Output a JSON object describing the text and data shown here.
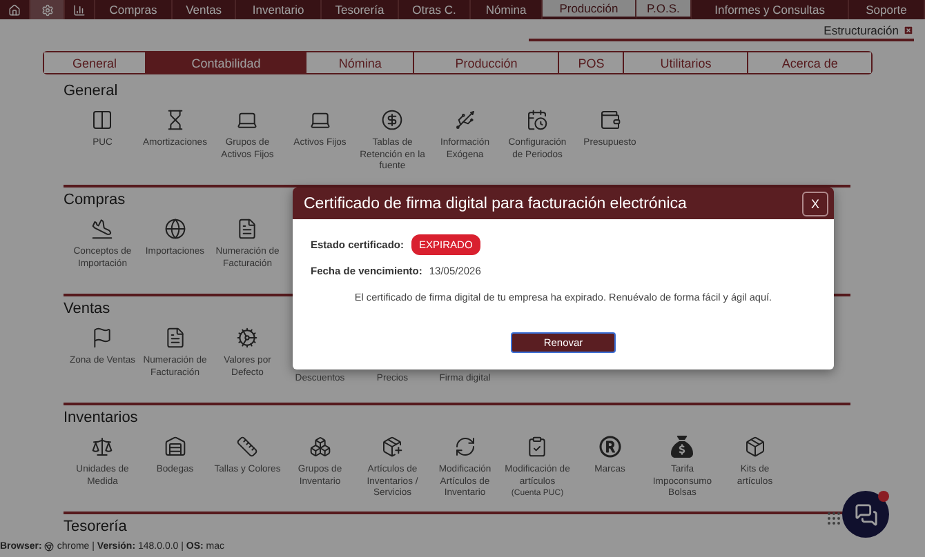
{
  "top_nav": {
    "icon_buttons": [
      {
        "kind": "home",
        "selected": false
      },
      {
        "kind": "settings",
        "selected": true
      },
      {
        "kind": "chart",
        "selected": false
      }
    ],
    "items": [
      {
        "label": "Compras",
        "selected": false
      },
      {
        "label": "Ventas",
        "selected": false
      },
      {
        "label": "Inventario",
        "selected": false
      },
      {
        "label": "Tesorería",
        "selected": false
      },
      {
        "label": "Otras C.",
        "selected": false
      },
      {
        "label": "Nómina",
        "selected": false
      },
      {
        "label": "Producción",
        "selected": true
      },
      {
        "label": "P.O.S.",
        "selected": true
      },
      {
        "label": "Informes y Consultas",
        "selected": false
      },
      {
        "label": "Soporte",
        "selected": false
      }
    ]
  },
  "panel_header": {
    "title": "Estructuración"
  },
  "tabs": [
    {
      "label": "General",
      "selected": false
    },
    {
      "label": "Contabilidad",
      "selected": true
    },
    {
      "label": "Nómina",
      "selected": false
    },
    {
      "label": "Producción",
      "selected": false
    },
    {
      "label": "POS",
      "selected": false
    },
    {
      "label": "Utilitarios",
      "selected": false
    },
    {
      "label": "Acerca de",
      "selected": false
    }
  ],
  "sections": [
    {
      "title": "General",
      "items": [
        {
          "label": "PUC"
        },
        {
          "label": "Amortizaciones"
        },
        {
          "label": "Grupos de Activos Fijos"
        },
        {
          "label": "Activos Fijos"
        },
        {
          "label": "Tablas de Retención en la fuente"
        },
        {
          "label": "Información Exógena"
        },
        {
          "label": "Configuración de Periodos"
        },
        {
          "label": "Presupuesto"
        }
      ]
    },
    {
      "title": "Compras",
      "items": [
        {
          "label": "Conceptos de Importación"
        },
        {
          "label": "Importaciones"
        },
        {
          "label": "Numeración de Facturación"
        }
      ]
    },
    {
      "title": "Ventas",
      "items": [
        {
          "label": "Zona de Ventas"
        },
        {
          "label": "Numeración de Facturación"
        },
        {
          "label": "Valores por Defecto"
        },
        {
          "label": "Descuentos"
        },
        {
          "label": "Precios"
        },
        {
          "label": "Firma digital"
        }
      ]
    },
    {
      "title": "Inventarios",
      "items": [
        {
          "label": "Unidades de Medida"
        },
        {
          "label": "Bodegas"
        },
        {
          "label": "Tallas y Colores"
        },
        {
          "label": "Grupos de Inventario"
        },
        {
          "label": "Artículos de Inventarios / Servicios"
        },
        {
          "label": "Modificación Artículos de Inventario"
        },
        {
          "label": "Modificación de artículos",
          "note": "(Cuenta PUC)"
        },
        {
          "label": "Marcas"
        },
        {
          "label": "Tarifa Impoconsumo Bolsas"
        },
        {
          "label": "Kits de artículos"
        }
      ]
    },
    {
      "title": "Tesorería"
    }
  ],
  "footer": {
    "label": "Browser:",
    "text": "chrome | **Versión:** 148.0.0.0 | **OS:** mac"
  },
  "modal": {
    "title": "Certificado de firma digital para facturación electrónica",
    "close": "X",
    "status_label": "Estado certificado:",
    "status": "EXPIRADO",
    "date_label": "Fecha de vencimiento:",
    "date": "13/05/2026",
    "message": "El certificado de firma digital de tu empresa ha expirado. Renuévalo de forma fácil y ágil aquí.",
    "button": "Renovar"
  }
}
